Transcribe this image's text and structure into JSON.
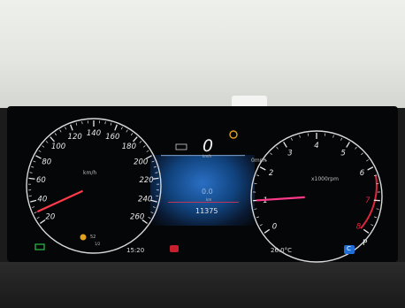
{
  "speedometer": {
    "unit": "km/h",
    "tick_labels": [
      "20",
      "40",
      "60",
      "80",
      "100",
      "120",
      "140",
      "160",
      "180",
      "200",
      "220",
      "240",
      "260"
    ],
    "needle_value": 10
  },
  "tachometer": {
    "unit": "x1000rpm",
    "tick_labels": [
      "0",
      "1",
      "2",
      "3",
      "4",
      "5",
      "6",
      "7",
      "8"
    ],
    "needle_value": 1
  },
  "center": {
    "gear": "0",
    "gear_small": "km/h",
    "speed_limit": "0mph",
    "trip_value": "0.0",
    "trip_unit": "km",
    "odometer": "11375"
  },
  "status": {
    "time": "15:20",
    "temperature": "26.0°C",
    "fuel_label": "52",
    "fuel_sub": "1/2",
    "gear_indicator": "P",
    "drive_mode": "C"
  },
  "colors": {
    "accent_red": "#e0263f",
    "accent_blue": "#1f6fd6",
    "warning_amber": "#e0a21c",
    "eco_green": "#29c24a"
  }
}
